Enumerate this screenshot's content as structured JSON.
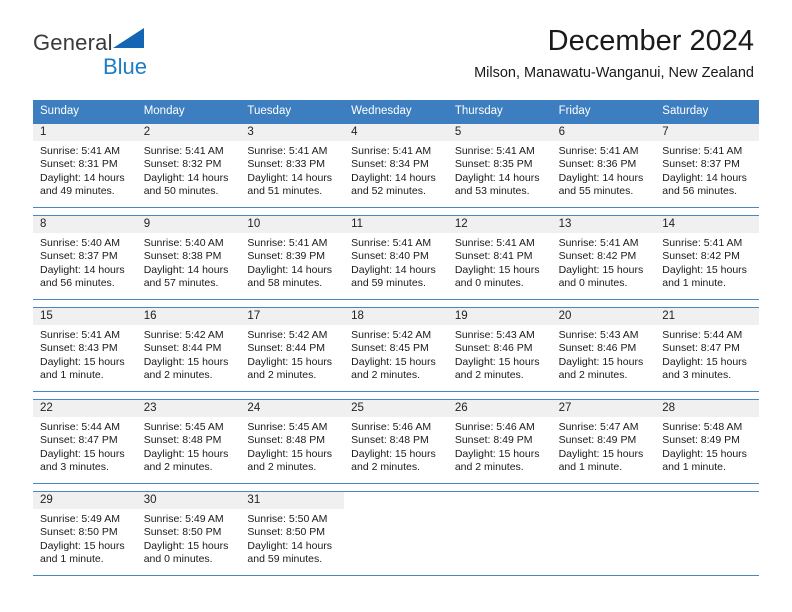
{
  "brand": {
    "line1": "General",
    "line2": "Blue",
    "flag_icon": "triangle-flag-icon",
    "accent_color": "#1d7cc6"
  },
  "header": {
    "title": "December 2024",
    "subtitle": "Milson, Manawatu-Wanganui, New Zealand"
  },
  "theme": {
    "header_row_color": "#3c7ebf",
    "row_divider_color": "#4a86c4",
    "daynum_band_color": "#f0f0f0"
  },
  "calendar": {
    "weekday_headers": [
      "Sunday",
      "Monday",
      "Tuesday",
      "Wednesday",
      "Thursday",
      "Friday",
      "Saturday"
    ],
    "weeks": [
      [
        {
          "day": "1",
          "lines": [
            "Sunrise: 5:41 AM",
            "Sunset: 8:31 PM",
            "Daylight: 14 hours",
            "and 49 minutes."
          ]
        },
        {
          "day": "2",
          "lines": [
            "Sunrise: 5:41 AM",
            "Sunset: 8:32 PM",
            "Daylight: 14 hours",
            "and 50 minutes."
          ]
        },
        {
          "day": "3",
          "lines": [
            "Sunrise: 5:41 AM",
            "Sunset: 8:33 PM",
            "Daylight: 14 hours",
            "and 51 minutes."
          ]
        },
        {
          "day": "4",
          "lines": [
            "Sunrise: 5:41 AM",
            "Sunset: 8:34 PM",
            "Daylight: 14 hours",
            "and 52 minutes."
          ]
        },
        {
          "day": "5",
          "lines": [
            "Sunrise: 5:41 AM",
            "Sunset: 8:35 PM",
            "Daylight: 14 hours",
            "and 53 minutes."
          ]
        },
        {
          "day": "6",
          "lines": [
            "Sunrise: 5:41 AM",
            "Sunset: 8:36 PM",
            "Daylight: 14 hours",
            "and 55 minutes."
          ]
        },
        {
          "day": "7",
          "lines": [
            "Sunrise: 5:41 AM",
            "Sunset: 8:37 PM",
            "Daylight: 14 hours",
            "and 56 minutes."
          ]
        }
      ],
      [
        {
          "day": "8",
          "lines": [
            "Sunrise: 5:40 AM",
            "Sunset: 8:37 PM",
            "Daylight: 14 hours",
            "and 56 minutes."
          ]
        },
        {
          "day": "9",
          "lines": [
            "Sunrise: 5:40 AM",
            "Sunset: 8:38 PM",
            "Daylight: 14 hours",
            "and 57 minutes."
          ]
        },
        {
          "day": "10",
          "lines": [
            "Sunrise: 5:41 AM",
            "Sunset: 8:39 PM",
            "Daylight: 14 hours",
            "and 58 minutes."
          ]
        },
        {
          "day": "11",
          "lines": [
            "Sunrise: 5:41 AM",
            "Sunset: 8:40 PM",
            "Daylight: 14 hours",
            "and 59 minutes."
          ]
        },
        {
          "day": "12",
          "lines": [
            "Sunrise: 5:41 AM",
            "Sunset: 8:41 PM",
            "Daylight: 15 hours",
            "and 0 minutes."
          ]
        },
        {
          "day": "13",
          "lines": [
            "Sunrise: 5:41 AM",
            "Sunset: 8:42 PM",
            "Daylight: 15 hours",
            "and 0 minutes."
          ]
        },
        {
          "day": "14",
          "lines": [
            "Sunrise: 5:41 AM",
            "Sunset: 8:42 PM",
            "Daylight: 15 hours",
            "and 1 minute."
          ]
        }
      ],
      [
        {
          "day": "15",
          "lines": [
            "Sunrise: 5:41 AM",
            "Sunset: 8:43 PM",
            "Daylight: 15 hours",
            "and 1 minute."
          ]
        },
        {
          "day": "16",
          "lines": [
            "Sunrise: 5:42 AM",
            "Sunset: 8:44 PM",
            "Daylight: 15 hours",
            "and 2 minutes."
          ]
        },
        {
          "day": "17",
          "lines": [
            "Sunrise: 5:42 AM",
            "Sunset: 8:44 PM",
            "Daylight: 15 hours",
            "and 2 minutes."
          ]
        },
        {
          "day": "18",
          "lines": [
            "Sunrise: 5:42 AM",
            "Sunset: 8:45 PM",
            "Daylight: 15 hours",
            "and 2 minutes."
          ]
        },
        {
          "day": "19",
          "lines": [
            "Sunrise: 5:43 AM",
            "Sunset: 8:46 PM",
            "Daylight: 15 hours",
            "and 2 minutes."
          ]
        },
        {
          "day": "20",
          "lines": [
            "Sunrise: 5:43 AM",
            "Sunset: 8:46 PM",
            "Daylight: 15 hours",
            "and 2 minutes."
          ]
        },
        {
          "day": "21",
          "lines": [
            "Sunrise: 5:44 AM",
            "Sunset: 8:47 PM",
            "Daylight: 15 hours",
            "and 3 minutes."
          ]
        }
      ],
      [
        {
          "day": "22",
          "lines": [
            "Sunrise: 5:44 AM",
            "Sunset: 8:47 PM",
            "Daylight: 15 hours",
            "and 3 minutes."
          ]
        },
        {
          "day": "23",
          "lines": [
            "Sunrise: 5:45 AM",
            "Sunset: 8:48 PM",
            "Daylight: 15 hours",
            "and 2 minutes."
          ]
        },
        {
          "day": "24",
          "lines": [
            "Sunrise: 5:45 AM",
            "Sunset: 8:48 PM",
            "Daylight: 15 hours",
            "and 2 minutes."
          ]
        },
        {
          "day": "25",
          "lines": [
            "Sunrise: 5:46 AM",
            "Sunset: 8:48 PM",
            "Daylight: 15 hours",
            "and 2 minutes."
          ]
        },
        {
          "day": "26",
          "lines": [
            "Sunrise: 5:46 AM",
            "Sunset: 8:49 PM",
            "Daylight: 15 hours",
            "and 2 minutes."
          ]
        },
        {
          "day": "27",
          "lines": [
            "Sunrise: 5:47 AM",
            "Sunset: 8:49 PM",
            "Daylight: 15 hours",
            "and 1 minute."
          ]
        },
        {
          "day": "28",
          "lines": [
            "Sunrise: 5:48 AM",
            "Sunset: 8:49 PM",
            "Daylight: 15 hours",
            "and 1 minute."
          ]
        }
      ],
      [
        {
          "day": "29",
          "lines": [
            "Sunrise: 5:49 AM",
            "Sunset: 8:50 PM",
            "Daylight: 15 hours",
            "and 1 minute."
          ]
        },
        {
          "day": "30",
          "lines": [
            "Sunrise: 5:49 AM",
            "Sunset: 8:50 PM",
            "Daylight: 15 hours",
            "and 0 minutes."
          ]
        },
        {
          "day": "31",
          "lines": [
            "Sunrise: 5:50 AM",
            "Sunset: 8:50 PM",
            "Daylight: 14 hours",
            "and 59 minutes."
          ]
        },
        {
          "day": "",
          "lines": []
        },
        {
          "day": "",
          "lines": []
        },
        {
          "day": "",
          "lines": []
        },
        {
          "day": "",
          "lines": []
        }
      ]
    ]
  }
}
